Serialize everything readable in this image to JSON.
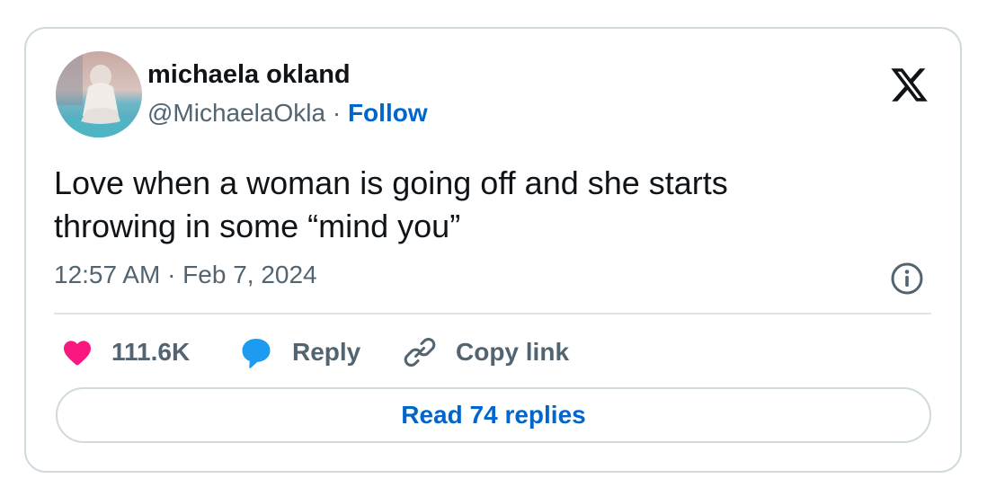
{
  "author": {
    "name": "michaela okland",
    "handle": "@MichaelaOkla",
    "separator": "·",
    "follow_label": "Follow"
  },
  "tweet": {
    "text_line1": "Love when a woman is going off and she starts",
    "text_line2": "throwing in some “mind you”",
    "timestamp": "12:57 AM · Feb 7, 2024"
  },
  "actions": {
    "like_count": "111.6K",
    "reply_label": "Reply",
    "copy_link_label": "Copy link"
  },
  "footer": {
    "read_replies_label": "Read 74 replies"
  },
  "icons": {
    "logo": "x-logo-icon",
    "info": "info-icon",
    "like": "heart-icon",
    "reply": "speech-bubble-icon",
    "copy": "link-icon"
  },
  "colors": {
    "heart": "#f91880",
    "reply_bubble": "#1d9bf0",
    "link_blue": "#0066cc",
    "text_primary": "#0f1419",
    "text_secondary": "#536471",
    "border": "#cfd9de"
  }
}
